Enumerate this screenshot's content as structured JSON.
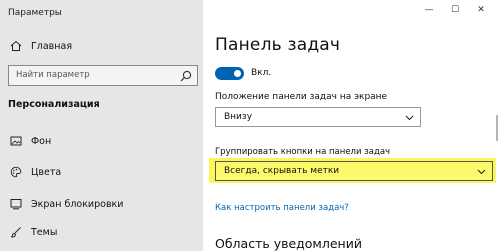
{
  "window": {
    "title": "Параметры",
    "controls": {
      "minimize": "—",
      "maximize": "☐",
      "close": "✕"
    }
  },
  "sidebar": {
    "home_label": "Главная",
    "search_placeholder": "Найти параметр",
    "section_title": "Персонализация",
    "items": [
      {
        "label": "Фон",
        "icon": "image-icon"
      },
      {
        "label": "Цвета",
        "icon": "palette-icon"
      },
      {
        "label": "Экран блокировки",
        "icon": "lock-screen-icon"
      },
      {
        "label": "Темы",
        "icon": "brush-icon"
      }
    ]
  },
  "main": {
    "title": "Панель задач",
    "toggle": {
      "label": "Вкл.",
      "on": true,
      "color": "#0063b1"
    },
    "position": {
      "label": "Положение панели задач на экране",
      "value": "Внизу"
    },
    "grouping": {
      "label": "Группировать кнопки на панели задач",
      "value": "Всегда, скрывать метки",
      "highlight": "#fbf65a"
    },
    "link": "Как настроить панели задач?",
    "notifications_title": "Область уведомлений"
  }
}
